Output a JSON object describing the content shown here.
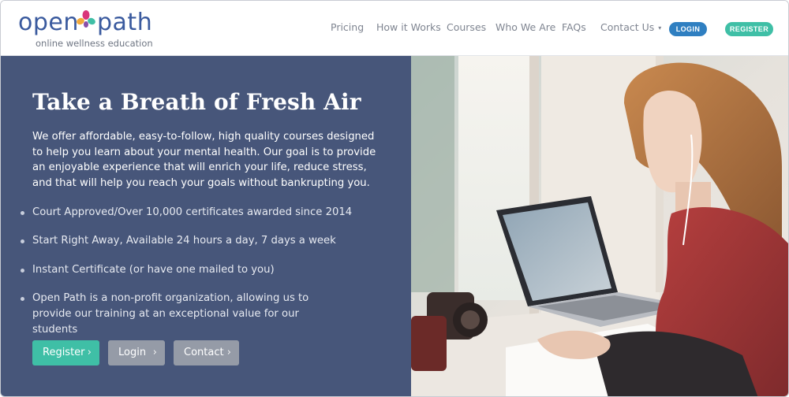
{
  "brand": {
    "word_left": "open",
    "word_right": "path",
    "tagline": "online wellness education",
    "colors": {
      "primary": "#3a5a9e",
      "teal": "#3fbfa6",
      "pink": "#d9357a",
      "orange": "#f2a93b"
    }
  },
  "nav": {
    "items": [
      {
        "label": "Pricing"
      },
      {
        "label": "How it Works"
      },
      {
        "label": "Courses"
      },
      {
        "label": "Who We Are"
      },
      {
        "label": "FAQs"
      },
      {
        "label": "Contact Us",
        "has_dropdown": true
      }
    ],
    "login_label": "LOGIN",
    "register_label": "REGISTER"
  },
  "hero": {
    "title": "Take a Breath of Fresh Air",
    "description": "We offer affordable, easy-to-follow, high quality courses designed to help you learn about your mental health. Our goal is to provide an enjoyable experience that will enrich your life, reduce stress, and that will help you reach your goals without bankrupting you.",
    "bullets": [
      "Court Approved/Over 10,000 certificates awarded since 2014",
      "Start Right Away, Available 24 hours a day, 7 days a week",
      "Instant Certificate (or have one mailed to you)",
      "Open Path is a non-profit organization, allowing us to provide our training at an exceptional value for our students"
    ],
    "buttons": {
      "register": "Register",
      "login": "Login",
      "contact": "Contact"
    },
    "chevron_icon": "chevron-right-icon",
    "colors": {
      "panel": "#47567a",
      "register": "#3fbfa6",
      "secondary": "#959ba7"
    }
  }
}
